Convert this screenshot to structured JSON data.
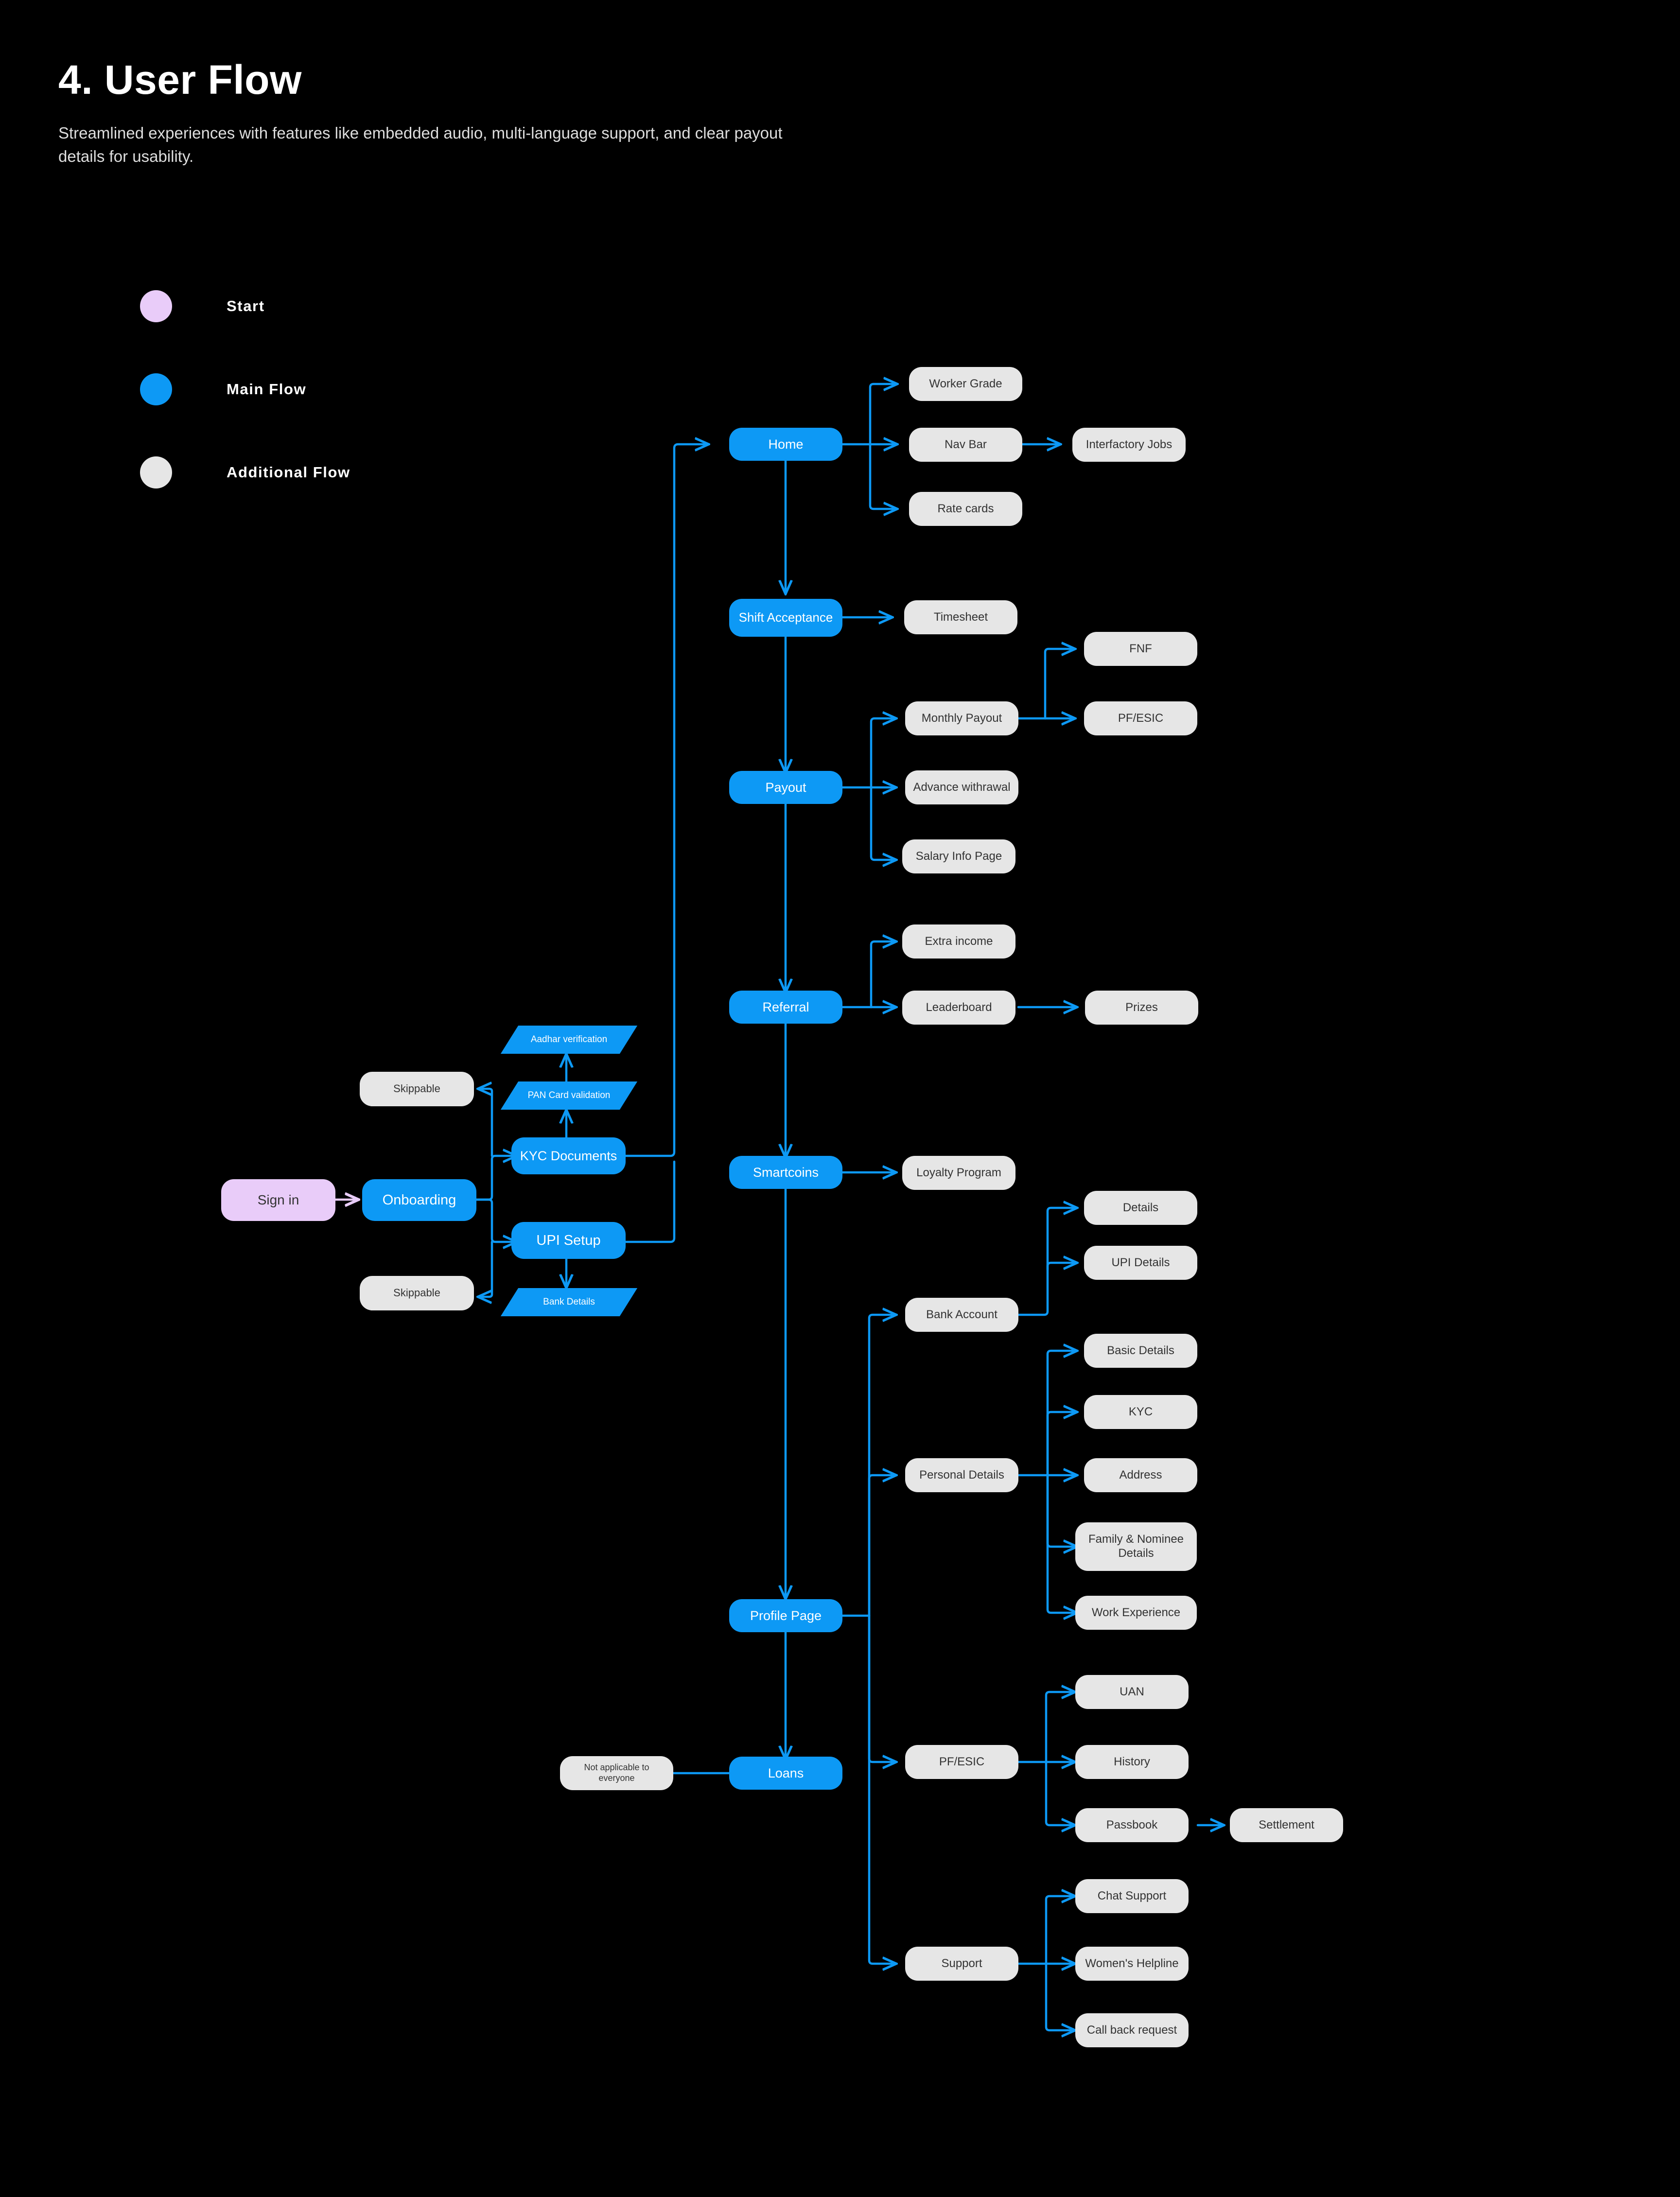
{
  "header": {
    "title": "4. User Flow",
    "subtitle": "Streamlined experiences with features like embedded audio, multi-language support, and clear payout details for usability."
  },
  "legend": {
    "items": [
      {
        "label": "Start",
        "color": "#e9ccf9"
      },
      {
        "label": "Main Flow",
        "color": "#0d99f5"
      },
      {
        "label": "Additional Flow",
        "color": "#e6e6e6"
      }
    ]
  },
  "colors": {
    "background": "#000000",
    "main_flow": "#0d99f5",
    "additional_flow": "#e6e6e6",
    "start": "#e9ccf9",
    "edge": "#0d99f5",
    "edge_start": "#e9ccf9"
  },
  "chart_data": {
    "type": "diagram",
    "title": "4. User Flow",
    "nodes": [
      {
        "id": "sign-in",
        "label": "Sign in",
        "kind": "start"
      },
      {
        "id": "onboarding",
        "label": "Onboarding",
        "kind": "main"
      },
      {
        "id": "skippable-kyc",
        "label": "Skippable",
        "kind": "extra"
      },
      {
        "id": "skippable-upi",
        "label": "Skippable",
        "kind": "extra"
      },
      {
        "id": "kyc-documents",
        "label": "KYC Documents",
        "kind": "main"
      },
      {
        "id": "pan-card",
        "label": "PAN Card validation",
        "kind": "parallelogram"
      },
      {
        "id": "aadhar",
        "label": "Aadhar verification",
        "kind": "parallelogram"
      },
      {
        "id": "upi-setup",
        "label": "UPI Setup",
        "kind": "main"
      },
      {
        "id": "bank-details",
        "label": "Bank Details",
        "kind": "parallelogram"
      },
      {
        "id": "home",
        "label": "Home",
        "kind": "main"
      },
      {
        "id": "worker-grade",
        "label": "Worker Grade",
        "kind": "extra"
      },
      {
        "id": "nav-bar",
        "label": "Nav Bar",
        "kind": "extra"
      },
      {
        "id": "interfactory-jobs",
        "label": "Interfactory Jobs",
        "kind": "extra"
      },
      {
        "id": "rate-cards",
        "label": "Rate cards",
        "kind": "extra"
      },
      {
        "id": "shift-acceptance",
        "label": "Shift Acceptance",
        "kind": "main"
      },
      {
        "id": "timesheet",
        "label": "Timesheet",
        "kind": "extra"
      },
      {
        "id": "payout",
        "label": "Payout",
        "kind": "main"
      },
      {
        "id": "monthly-payout",
        "label": "Monthly Payout",
        "kind": "extra"
      },
      {
        "id": "fnf",
        "label": "FNF",
        "kind": "extra"
      },
      {
        "id": "pf-esic-payout",
        "label": "PF/ESIC",
        "kind": "extra"
      },
      {
        "id": "advance-withrawal",
        "label": "Advance withrawal",
        "kind": "extra"
      },
      {
        "id": "salary-info-page",
        "label": "Salary Info Page",
        "kind": "extra"
      },
      {
        "id": "referral",
        "label": "Referral",
        "kind": "main"
      },
      {
        "id": "extra-income",
        "label": "Extra income",
        "kind": "extra"
      },
      {
        "id": "leaderboard",
        "label": "Leaderboard",
        "kind": "extra"
      },
      {
        "id": "prizes",
        "label": "Prizes",
        "kind": "extra"
      },
      {
        "id": "smartcoins",
        "label": "Smartcoins",
        "kind": "main"
      },
      {
        "id": "loyalty-program",
        "label": "Loyalty Program",
        "kind": "extra"
      },
      {
        "id": "profile-page",
        "label": "Profile Page",
        "kind": "main"
      },
      {
        "id": "bank-account",
        "label": "Bank Account",
        "kind": "extra"
      },
      {
        "id": "details",
        "label": "Details",
        "kind": "extra"
      },
      {
        "id": "upi-details",
        "label": "UPI Details",
        "kind": "extra"
      },
      {
        "id": "personal-details",
        "label": "Personal Details",
        "kind": "extra"
      },
      {
        "id": "basic-details",
        "label": "Basic Details",
        "kind": "extra"
      },
      {
        "id": "kyc",
        "label": "KYC",
        "kind": "extra"
      },
      {
        "id": "address",
        "label": "Address",
        "kind": "extra"
      },
      {
        "id": "family-nominee",
        "label": "Family & Nominee Details",
        "kind": "extra"
      },
      {
        "id": "work-experience",
        "label": "Work Experience",
        "kind": "extra"
      },
      {
        "id": "loans",
        "label": "Loans",
        "kind": "main"
      },
      {
        "id": "not-applicable",
        "label": "Not applicable to everyone",
        "kind": "extra"
      },
      {
        "id": "pf-esic",
        "label": "PF/ESIC",
        "kind": "extra"
      },
      {
        "id": "uan",
        "label": "UAN",
        "kind": "extra"
      },
      {
        "id": "history",
        "label": "History",
        "kind": "extra"
      },
      {
        "id": "passbook",
        "label": "Passbook",
        "kind": "extra"
      },
      {
        "id": "settlement",
        "label": "Settlement",
        "kind": "extra"
      },
      {
        "id": "support",
        "label": "Support",
        "kind": "extra"
      },
      {
        "id": "chat-support",
        "label": "Chat Support",
        "kind": "extra"
      },
      {
        "id": "womens-helpline",
        "label": "Women's Helpline",
        "kind": "extra"
      },
      {
        "id": "call-back-request",
        "label": "Call back request",
        "kind": "extra"
      }
    ],
    "edges": [
      [
        "sign-in",
        "onboarding"
      ],
      [
        "onboarding",
        "kyc-documents"
      ],
      [
        "onboarding",
        "upi-setup"
      ],
      [
        "kyc-documents",
        "skippable-kyc"
      ],
      [
        "upi-setup",
        "skippable-upi"
      ],
      [
        "kyc-documents",
        "pan-card"
      ],
      [
        "pan-card",
        "aadhar"
      ],
      [
        "upi-setup",
        "bank-details"
      ],
      [
        "kyc-documents",
        "home"
      ],
      [
        "upi-setup",
        "home"
      ],
      [
        "home",
        "worker-grade"
      ],
      [
        "home",
        "nav-bar"
      ],
      [
        "nav-bar",
        "interfactory-jobs"
      ],
      [
        "home",
        "rate-cards"
      ],
      [
        "home",
        "shift-acceptance"
      ],
      [
        "shift-acceptance",
        "timesheet"
      ],
      [
        "shift-acceptance",
        "payout"
      ],
      [
        "payout",
        "monthly-payout"
      ],
      [
        "monthly-payout",
        "fnf"
      ],
      [
        "monthly-payout",
        "pf-esic-payout"
      ],
      [
        "payout",
        "advance-withrawal"
      ],
      [
        "payout",
        "salary-info-page"
      ],
      [
        "payout",
        "referral"
      ],
      [
        "referral",
        "extra-income"
      ],
      [
        "referral",
        "leaderboard"
      ],
      [
        "leaderboard",
        "prizes"
      ],
      [
        "referral",
        "smartcoins"
      ],
      [
        "smartcoins",
        "loyalty-program"
      ],
      [
        "smartcoins",
        "profile-page"
      ],
      [
        "profile-page",
        "bank-account"
      ],
      [
        "bank-account",
        "details"
      ],
      [
        "bank-account",
        "upi-details"
      ],
      [
        "profile-page",
        "personal-details"
      ],
      [
        "personal-details",
        "basic-details"
      ],
      [
        "personal-details",
        "kyc"
      ],
      [
        "personal-details",
        "address"
      ],
      [
        "personal-details",
        "family-nominee"
      ],
      [
        "personal-details",
        "work-experience"
      ],
      [
        "profile-page",
        "pf-esic"
      ],
      [
        "pf-esic",
        "uan"
      ],
      [
        "pf-esic",
        "history"
      ],
      [
        "pf-esic",
        "passbook"
      ],
      [
        "passbook",
        "settlement"
      ],
      [
        "profile-page",
        "support"
      ],
      [
        "support",
        "chat-support"
      ],
      [
        "support",
        "womens-helpline"
      ],
      [
        "support",
        "call-back-request"
      ],
      [
        "profile-page",
        "loans"
      ],
      [
        "loans",
        "not-applicable"
      ]
    ]
  },
  "nodes": {
    "sign_in": "Sign in",
    "onboarding": "Onboarding",
    "skippable_kyc": "Skippable",
    "skippable_upi": "Skippable",
    "kyc_documents": "KYC Documents",
    "pan_card": "PAN Card validation",
    "aadhar": "Aadhar verification",
    "upi_setup": "UPI Setup",
    "bank_details": "Bank Details",
    "home": "Home",
    "worker_grade": "Worker Grade",
    "nav_bar": "Nav Bar",
    "interfactory_jobs": "Interfactory Jobs",
    "rate_cards": "Rate cards",
    "shift_acceptance": "Shift Acceptance",
    "timesheet": "Timesheet",
    "payout": "Payout",
    "monthly_payout": "Monthly Payout",
    "fnf": "FNF",
    "pf_esic_payout": "PF/ESIC",
    "advance_withrawal": "Advance withrawal",
    "salary_info_page": "Salary Info Page",
    "referral": "Referral",
    "extra_income": "Extra income",
    "leaderboard": "Leaderboard",
    "prizes": "Prizes",
    "smartcoins": "Smartcoins",
    "loyalty_program": "Loyalty Program",
    "profile_page": "Profile Page",
    "bank_account": "Bank Account",
    "details": "Details",
    "upi_details": "UPI Details",
    "personal_details": "Personal Details",
    "basic_details": "Basic Details",
    "kyc": "KYC",
    "address": "Address",
    "family_nominee": "Family & Nominee Details",
    "work_experience": "Work Experience",
    "loans": "Loans",
    "not_applicable": "Not applicable to everyone",
    "pf_esic": "PF/ESIC",
    "uan": "UAN",
    "history": "History",
    "passbook": "Passbook",
    "settlement": "Settlement",
    "support": "Support",
    "chat_support": "Chat Support",
    "womens_helpline": "Women's Helpline",
    "call_back_request": "Call back request"
  }
}
